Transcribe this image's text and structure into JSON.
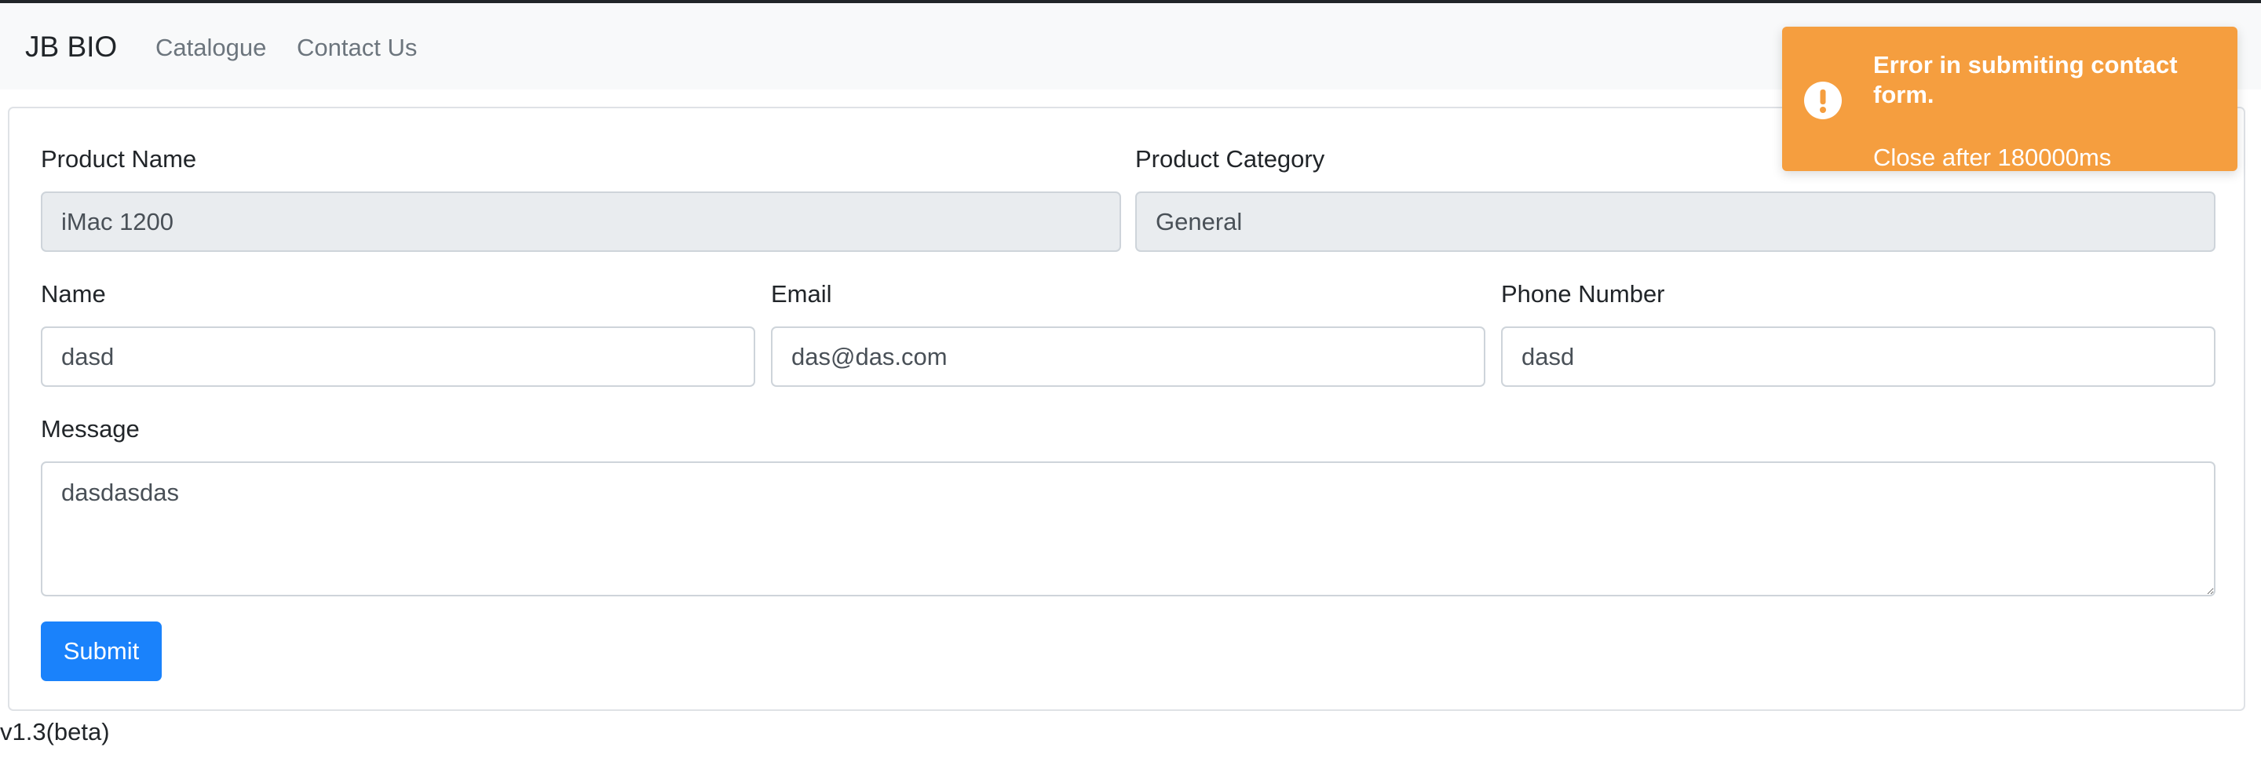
{
  "navbar": {
    "brand": "JB BIO",
    "links": [
      "Catalogue",
      "Contact Us"
    ]
  },
  "form": {
    "product_name": {
      "label": "Product Name",
      "value": "iMac 1200"
    },
    "product_category": {
      "label": "Product Category",
      "value": "General"
    },
    "name": {
      "label": "Name",
      "value": "dasd"
    },
    "email": {
      "label": "Email",
      "value": "das@das.com"
    },
    "phone": {
      "label": "Phone Number",
      "value": "dasd"
    },
    "message": {
      "label": "Message",
      "value": "dasdasdas"
    },
    "submit_label": "Submit"
  },
  "footer": {
    "version": "v1.3(beta)"
  },
  "toast": {
    "title": "Error in submiting contact form.",
    "subtitle": "Close after 180000ms",
    "icon": "exclamation-circle-icon",
    "color": "#f59e3f"
  },
  "colors": {
    "primary": "#1a82fb",
    "navbar_bg": "#f8f9fa",
    "readonly_bg": "#e9ecef"
  }
}
